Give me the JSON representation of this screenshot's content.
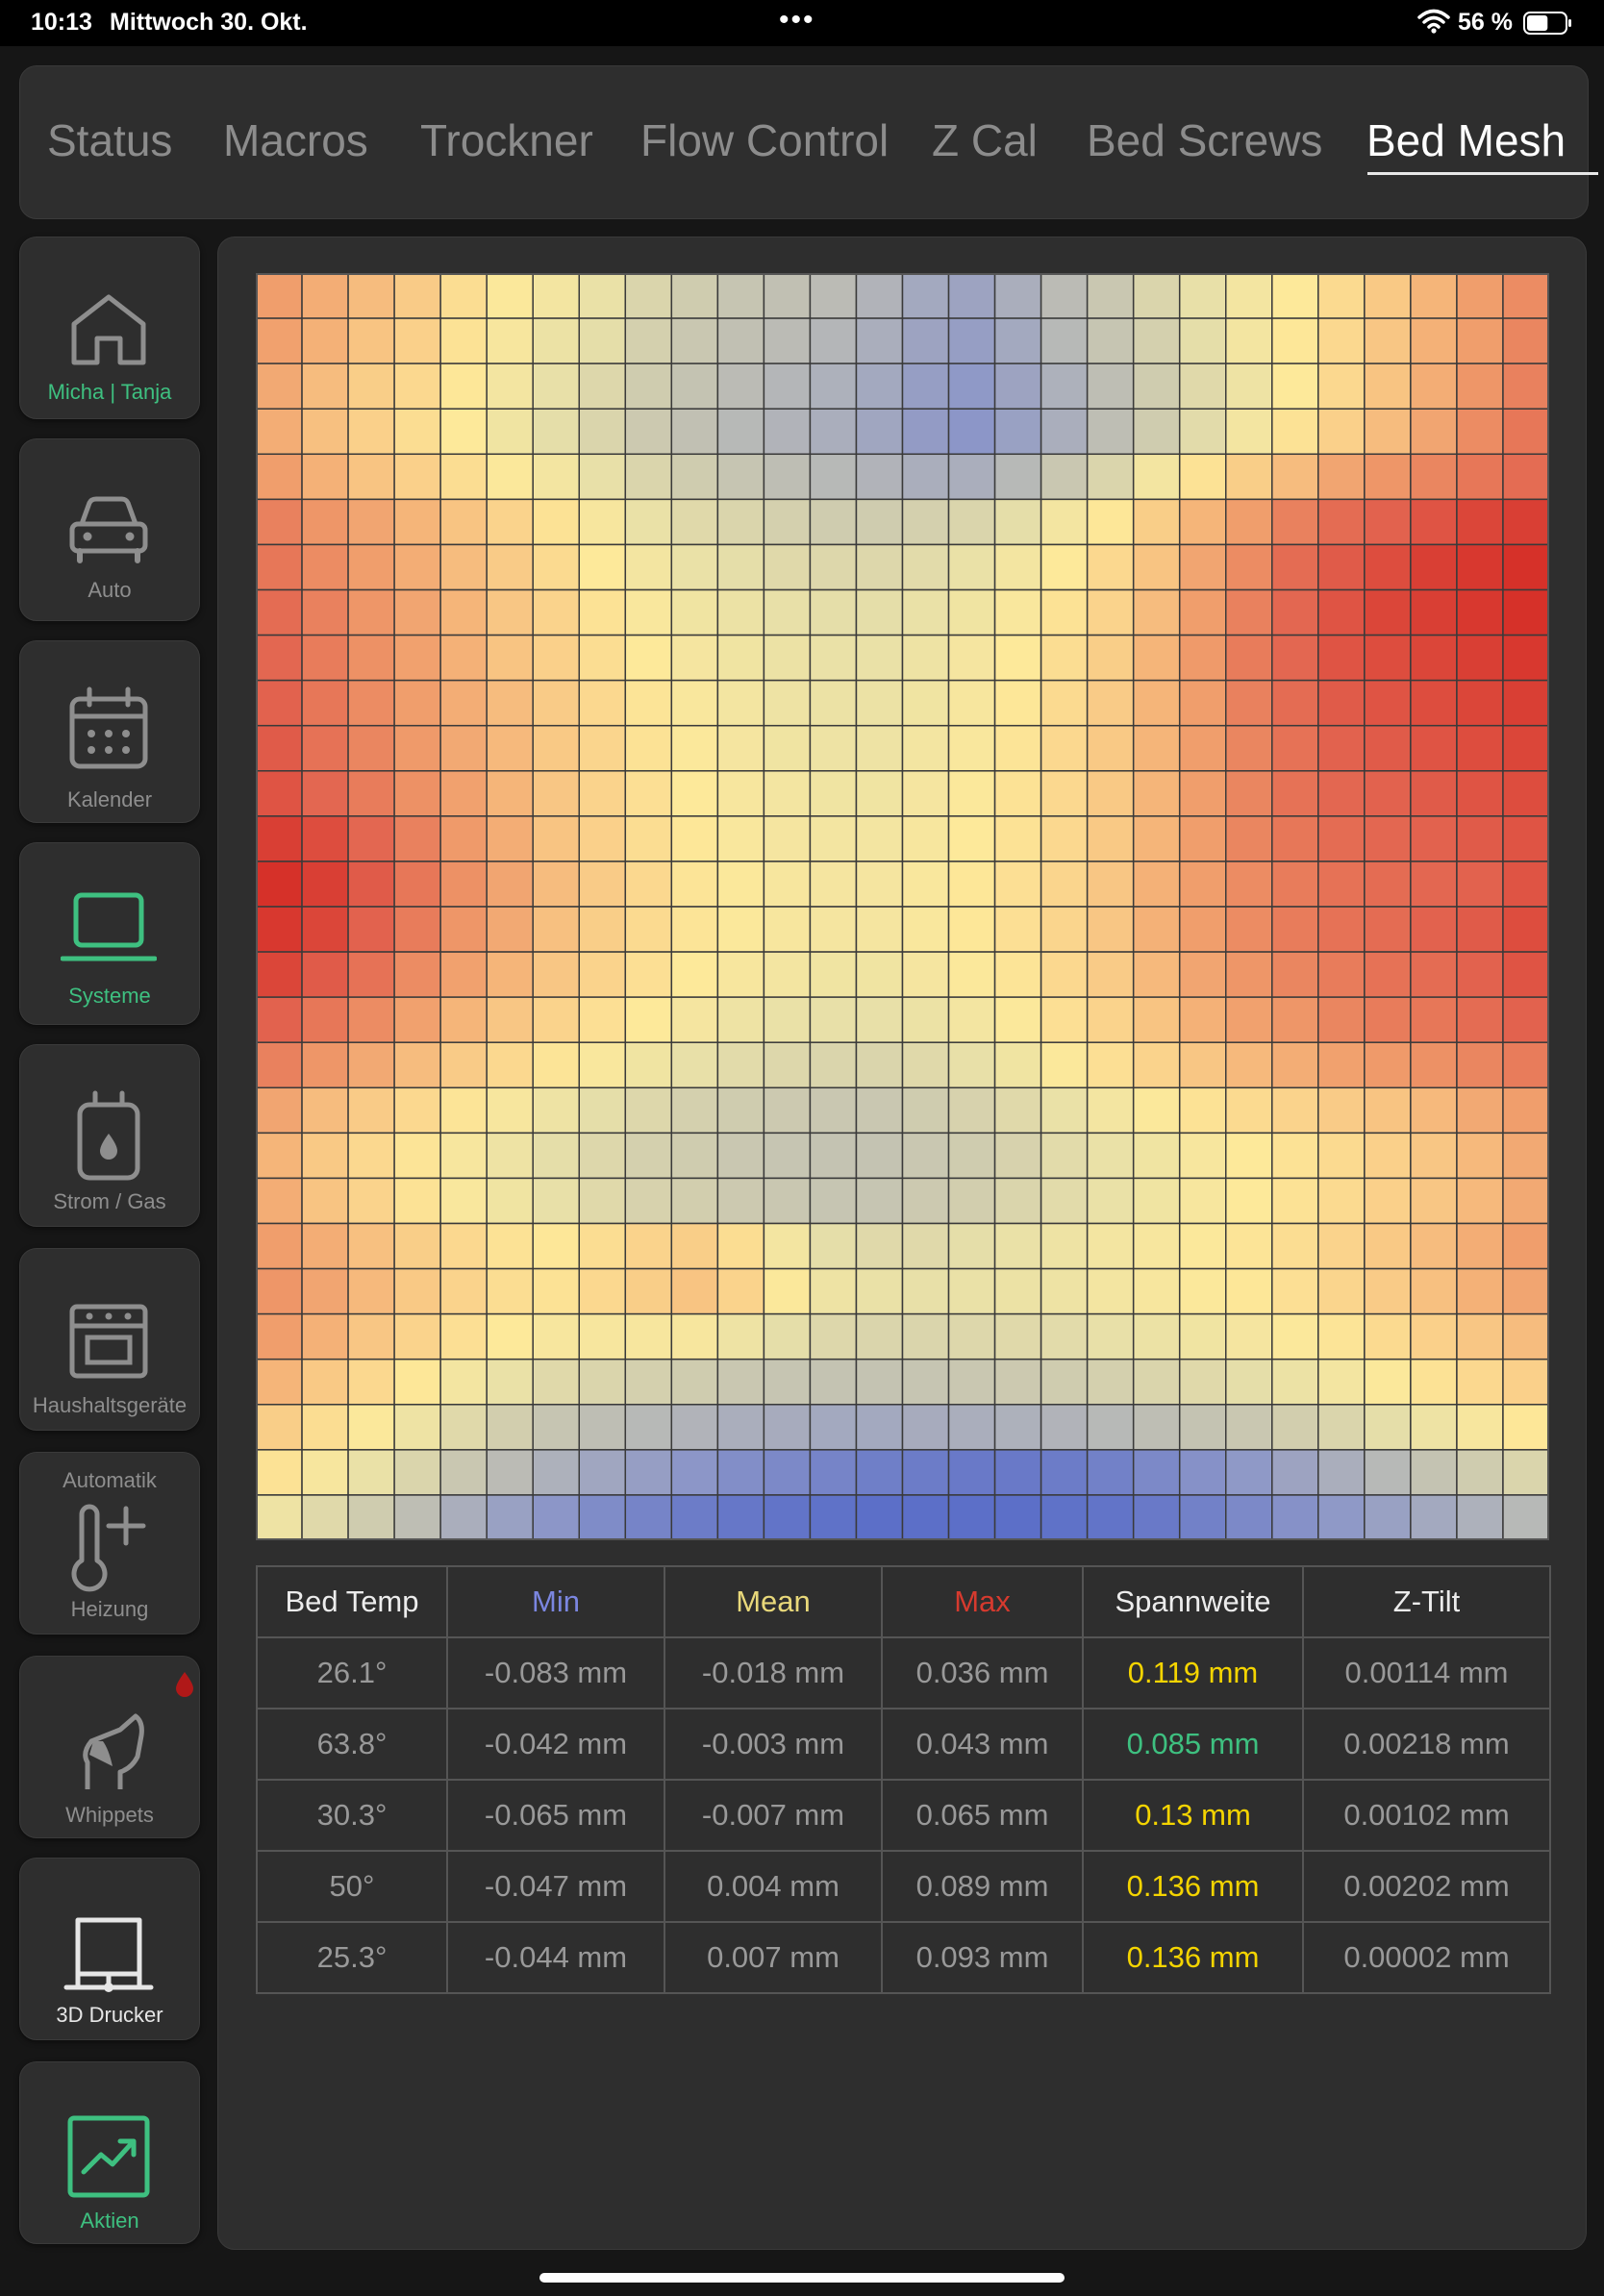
{
  "statusbar": {
    "time": "10:13",
    "date": "Mittwoch 30. Okt.",
    "dots": "•••",
    "battery_percent": "56 %",
    "battery_level": 0.56
  },
  "tabs": [
    {
      "label": "Status",
      "active": false
    },
    {
      "label": "Macros",
      "active": false
    },
    {
      "label": "Trockner",
      "active": false
    },
    {
      "label": "Flow Control",
      "active": false
    },
    {
      "label": "Z Cal",
      "active": false
    },
    {
      "label": "Bed Screws",
      "active": false
    },
    {
      "label": "Bed Mesh",
      "active": true
    }
  ],
  "sidebar": {
    "items": [
      {
        "label": "Micha | Tanja",
        "icon": "home-icon",
        "active": true
      },
      {
        "label": "Auto",
        "icon": "car-icon",
        "active": false
      },
      {
        "label": "Kalender",
        "icon": "calendar-icon",
        "active": false
      },
      {
        "label": "Systeme",
        "icon": "laptop-icon",
        "active": true
      },
      {
        "label": "Strom / Gas",
        "icon": "meter-icon",
        "active": false
      },
      {
        "label": "Haushaltsgeräte",
        "icon": "oven-icon",
        "active": false
      },
      {
        "label": "Heizung",
        "top_label": "Automatik",
        "icon": "thermometer-icon",
        "active": false
      },
      {
        "label": "Whippets",
        "icon": "dog-icon",
        "active": false,
        "badge_color": "#b01818"
      },
      {
        "label": "3D Drucker",
        "icon": "printer-icon",
        "active": false,
        "highlight": true
      },
      {
        "label": "Aktien",
        "icon": "chart-up-icon",
        "active": true
      }
    ]
  },
  "colors": {
    "accent_green": "#3ec080",
    "min_header": "#7b86e0",
    "mean_header": "#e8d87a",
    "max_header": "#d63a2e",
    "range_yellow": "#f4d400",
    "heat_low": "#5c6fc8",
    "heat_mid": "#fde99a",
    "heat_high": "#d42a24"
  },
  "stats_table": {
    "headers": [
      "Bed Temp",
      "Min",
      "Mean",
      "Max",
      "Spannweite",
      "Z-Tilt"
    ],
    "rows": [
      [
        "26.1°",
        "-0.083 mm",
        "-0.018 mm",
        "0.036 mm",
        "0.119 mm",
        "0.00114 mm"
      ],
      [
        "63.8°",
        "-0.042 mm",
        "-0.003 mm",
        "0.043 mm",
        "0.085 mm",
        "0.00218 mm"
      ],
      [
        "30.3°",
        "-0.065 mm",
        "-0.007 mm",
        "0.065 mm",
        "0.13 mm",
        "0.00102 mm"
      ],
      [
        "50°",
        "-0.047 mm",
        "0.004 mm",
        "0.089 mm",
        "0.136 mm",
        "0.00202 mm"
      ],
      [
        "25.3°",
        "-0.044 mm",
        "0.007 mm",
        "0.093 mm",
        "0.136 mm",
        "0.00002 mm"
      ]
    ],
    "range_colors": [
      "yellow",
      "green",
      "yellow",
      "yellow",
      "yellow"
    ]
  },
  "chart_data": {
    "type": "heatmap",
    "grid": {
      "cols": 28,
      "rows": 28
    },
    "values_normalized": [
      [
        0.8,
        0.76,
        0.72,
        0.67,
        0.6,
        0.54,
        0.5,
        0.46,
        0.4,
        0.36,
        0.33,
        0.31,
        0.29,
        0.26,
        0.22,
        0.2,
        0.24,
        0.29,
        0.34,
        0.4,
        0.45,
        0.5,
        0.55,
        0.61,
        0.68,
        0.74,
        0.8,
        0.84
      ],
      [
        0.79,
        0.75,
        0.7,
        0.65,
        0.58,
        0.52,
        0.47,
        0.44,
        0.38,
        0.34,
        0.31,
        0.29,
        0.27,
        0.24,
        0.2,
        0.18,
        0.22,
        0.28,
        0.33,
        0.38,
        0.44,
        0.5,
        0.56,
        0.62,
        0.69,
        0.75,
        0.8,
        0.85
      ],
      [
        0.77,
        0.72,
        0.66,
        0.62,
        0.56,
        0.5,
        0.45,
        0.41,
        0.36,
        0.32,
        0.29,
        0.27,
        0.25,
        0.22,
        0.18,
        0.16,
        0.2,
        0.25,
        0.3,
        0.36,
        0.42,
        0.48,
        0.55,
        0.62,
        0.7,
        0.76,
        0.82,
        0.86
      ],
      [
        0.76,
        0.71,
        0.65,
        0.6,
        0.55,
        0.49,
        0.44,
        0.4,
        0.35,
        0.31,
        0.28,
        0.26,
        0.24,
        0.21,
        0.17,
        0.15,
        0.19,
        0.24,
        0.3,
        0.36,
        0.43,
        0.5,
        0.58,
        0.65,
        0.72,
        0.78,
        0.84,
        0.88
      ],
      [
        0.8,
        0.75,
        0.7,
        0.65,
        0.6,
        0.54,
        0.5,
        0.45,
        0.4,
        0.36,
        0.33,
        0.3,
        0.28,
        0.26,
        0.24,
        0.24,
        0.28,
        0.34,
        0.4,
        0.5,
        0.58,
        0.66,
        0.72,
        0.78,
        0.82,
        0.85,
        0.88,
        0.9
      ],
      [
        0.86,
        0.82,
        0.78,
        0.74,
        0.7,
        0.64,
        0.58,
        0.52,
        0.46,
        0.42,
        0.4,
        0.38,
        0.36,
        0.36,
        0.38,
        0.4,
        0.44,
        0.5,
        0.56,
        0.66,
        0.74,
        0.8,
        0.86,
        0.9,
        0.92,
        0.94,
        0.96,
        0.97
      ],
      [
        0.88,
        0.84,
        0.8,
        0.76,
        0.72,
        0.67,
        0.61,
        0.55,
        0.5,
        0.46,
        0.44,
        0.42,
        0.41,
        0.41,
        0.43,
        0.46,
        0.5,
        0.55,
        0.62,
        0.7,
        0.78,
        0.84,
        0.9,
        0.93,
        0.95,
        0.97,
        0.98,
        0.99
      ],
      [
        0.9,
        0.86,
        0.82,
        0.78,
        0.74,
        0.69,
        0.64,
        0.58,
        0.53,
        0.49,
        0.47,
        0.45,
        0.44,
        0.44,
        0.46,
        0.49,
        0.53,
        0.58,
        0.64,
        0.72,
        0.8,
        0.86,
        0.91,
        0.94,
        0.96,
        0.97,
        0.98,
        0.99
      ],
      [
        0.91,
        0.87,
        0.83,
        0.79,
        0.75,
        0.7,
        0.65,
        0.6,
        0.55,
        0.51,
        0.49,
        0.47,
        0.46,
        0.46,
        0.48,
        0.51,
        0.55,
        0.6,
        0.66,
        0.74,
        0.81,
        0.87,
        0.91,
        0.94,
        0.95,
        0.96,
        0.97,
        0.98
      ],
      [
        0.92,
        0.88,
        0.84,
        0.8,
        0.76,
        0.72,
        0.67,
        0.62,
        0.57,
        0.53,
        0.5,
        0.48,
        0.47,
        0.47,
        0.49,
        0.52,
        0.56,
        0.61,
        0.67,
        0.74,
        0.8,
        0.86,
        0.9,
        0.93,
        0.94,
        0.95,
        0.96,
        0.97
      ],
      [
        0.93,
        0.89,
        0.85,
        0.81,
        0.77,
        0.73,
        0.68,
        0.63,
        0.58,
        0.54,
        0.51,
        0.49,
        0.48,
        0.48,
        0.5,
        0.53,
        0.57,
        0.62,
        0.68,
        0.74,
        0.8,
        0.85,
        0.89,
        0.92,
        0.93,
        0.94,
        0.95,
        0.96
      ],
      [
        0.94,
        0.91,
        0.87,
        0.83,
        0.79,
        0.74,
        0.69,
        0.64,
        0.59,
        0.55,
        0.52,
        0.5,
        0.49,
        0.49,
        0.51,
        0.54,
        0.58,
        0.62,
        0.68,
        0.74,
        0.8,
        0.85,
        0.89,
        0.91,
        0.92,
        0.93,
        0.94,
        0.95
      ],
      [
        0.97,
        0.95,
        0.91,
        0.86,
        0.81,
        0.76,
        0.7,
        0.65,
        0.6,
        0.56,
        0.53,
        0.51,
        0.5,
        0.5,
        0.52,
        0.55,
        0.58,
        0.62,
        0.68,
        0.74,
        0.8,
        0.85,
        0.88,
        0.9,
        0.91,
        0.92,
        0.93,
        0.94
      ],
      [
        0.99,
        0.97,
        0.93,
        0.88,
        0.83,
        0.78,
        0.72,
        0.67,
        0.62,
        0.57,
        0.54,
        0.52,
        0.51,
        0.51,
        0.53,
        0.56,
        0.59,
        0.63,
        0.69,
        0.75,
        0.8,
        0.84,
        0.87,
        0.89,
        0.9,
        0.91,
        0.92,
        0.94
      ],
      [
        0.98,
        0.96,
        0.92,
        0.87,
        0.82,
        0.77,
        0.71,
        0.66,
        0.61,
        0.57,
        0.54,
        0.52,
        0.51,
        0.51,
        0.53,
        0.56,
        0.59,
        0.63,
        0.69,
        0.75,
        0.8,
        0.84,
        0.87,
        0.89,
        0.9,
        0.92,
        0.93,
        0.95
      ],
      [
        0.96,
        0.93,
        0.89,
        0.84,
        0.79,
        0.74,
        0.69,
        0.64,
        0.59,
        0.55,
        0.52,
        0.5,
        0.49,
        0.49,
        0.51,
        0.54,
        0.57,
        0.62,
        0.67,
        0.73,
        0.78,
        0.82,
        0.85,
        0.87,
        0.89,
        0.9,
        0.92,
        0.94
      ],
      [
        0.92,
        0.88,
        0.84,
        0.79,
        0.74,
        0.69,
        0.64,
        0.59,
        0.55,
        0.51,
        0.48,
        0.46,
        0.45,
        0.45,
        0.47,
        0.5,
        0.54,
        0.59,
        0.64,
        0.7,
        0.75,
        0.79,
        0.82,
        0.85,
        0.87,
        0.88,
        0.9,
        0.92
      ],
      [
        0.86,
        0.82,
        0.77,
        0.72,
        0.67,
        0.62,
        0.57,
        0.53,
        0.49,
        0.45,
        0.43,
        0.41,
        0.4,
        0.4,
        0.42,
        0.45,
        0.49,
        0.54,
        0.59,
        0.64,
        0.69,
        0.73,
        0.76,
        0.79,
        0.81,
        0.83,
        0.85,
        0.87
      ],
      [
        0.78,
        0.72,
        0.67,
        0.62,
        0.57,
        0.52,
        0.48,
        0.44,
        0.41,
        0.38,
        0.36,
        0.35,
        0.34,
        0.34,
        0.36,
        0.39,
        0.42,
        0.46,
        0.5,
        0.54,
        0.58,
        0.61,
        0.64,
        0.67,
        0.7,
        0.73,
        0.77,
        0.8
      ],
      [
        0.74,
        0.68,
        0.62,
        0.57,
        0.52,
        0.48,
        0.44,
        0.41,
        0.38,
        0.36,
        0.34,
        0.33,
        0.32,
        0.32,
        0.34,
        0.36,
        0.39,
        0.43,
        0.46,
        0.49,
        0.52,
        0.55,
        0.58,
        0.61,
        0.65,
        0.69,
        0.73,
        0.77
      ],
      [
        0.76,
        0.7,
        0.64,
        0.58,
        0.53,
        0.49,
        0.45,
        0.42,
        0.39,
        0.37,
        0.35,
        0.34,
        0.33,
        0.33,
        0.35,
        0.37,
        0.4,
        0.43,
        0.46,
        0.49,
        0.52,
        0.55,
        0.58,
        0.61,
        0.65,
        0.69,
        0.73,
        0.77
      ],
      [
        0.8,
        0.76,
        0.71,
        0.66,
        0.62,
        0.58,
        0.56,
        0.6,
        0.64,
        0.66,
        0.6,
        0.5,
        0.44,
        0.42,
        0.42,
        0.44,
        0.46,
        0.48,
        0.5,
        0.52,
        0.54,
        0.57,
        0.6,
        0.64,
        0.68,
        0.72,
        0.76,
        0.8
      ],
      [
        0.82,
        0.78,
        0.73,
        0.68,
        0.64,
        0.6,
        0.58,
        0.62,
        0.66,
        0.7,
        0.64,
        0.54,
        0.48,
        0.46,
        0.45,
        0.46,
        0.47,
        0.48,
        0.5,
        0.52,
        0.54,
        0.56,
        0.59,
        0.63,
        0.67,
        0.71,
        0.75,
        0.78
      ],
      [
        0.8,
        0.75,
        0.69,
        0.64,
        0.59,
        0.55,
        0.52,
        0.52,
        0.52,
        0.52,
        0.48,
        0.44,
        0.41,
        0.4,
        0.4,
        0.41,
        0.42,
        0.43,
        0.45,
        0.47,
        0.49,
        0.51,
        0.54,
        0.57,
        0.61,
        0.65,
        0.69,
        0.72
      ],
      [
        0.74,
        0.68,
        0.62,
        0.56,
        0.5,
        0.46,
        0.42,
        0.4,
        0.38,
        0.36,
        0.34,
        0.33,
        0.32,
        0.32,
        0.33,
        0.34,
        0.35,
        0.36,
        0.38,
        0.4,
        0.42,
        0.44,
        0.47,
        0.5,
        0.54,
        0.58,
        0.62,
        0.65
      ],
      [
        0.66,
        0.6,
        0.54,
        0.48,
        0.42,
        0.37,
        0.33,
        0.3,
        0.28,
        0.26,
        0.24,
        0.23,
        0.22,
        0.22,
        0.23,
        0.24,
        0.25,
        0.26,
        0.28,
        0.3,
        0.32,
        0.34,
        0.37,
        0.4,
        0.44,
        0.48,
        0.52,
        0.56
      ],
      [
        0.58,
        0.52,
        0.46,
        0.4,
        0.34,
        0.29,
        0.25,
        0.21,
        0.18,
        0.15,
        0.12,
        0.1,
        0.08,
        0.06,
        0.05,
        0.04,
        0.04,
        0.05,
        0.07,
        0.1,
        0.13,
        0.16,
        0.2,
        0.24,
        0.28,
        0.32,
        0.36,
        0.4
      ],
      [
        0.48,
        0.42,
        0.36,
        0.3,
        0.24,
        0.19,
        0.15,
        0.11,
        0.08,
        0.05,
        0.03,
        0.02,
        0.01,
        0.0,
        0.0,
        0.0,
        0.0,
        0.01,
        0.02,
        0.04,
        0.07,
        0.1,
        0.13,
        0.16,
        0.19,
        0.22,
        0.25,
        0.28
      ]
    ]
  }
}
